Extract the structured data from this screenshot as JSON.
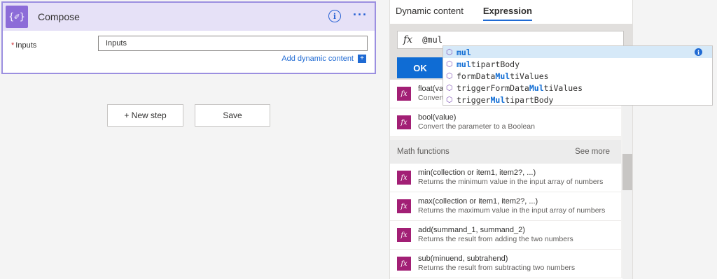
{
  "compose": {
    "title": "Compose",
    "icon": "compose-curly-icon",
    "icon_glyph": "{✐}",
    "info_glyph": "i",
    "more_glyph": "···",
    "required_mark": "*",
    "inputs_label": "Inputs",
    "inputs_value": "Inputs",
    "add_dynamic_label": "Add dynamic content",
    "add_dynamic_glyph": "+"
  },
  "actions": {
    "new_step_label": "+ New step",
    "save_label": "Save"
  },
  "panel": {
    "tabs": [
      "Dynamic content",
      "Expression"
    ],
    "active_tab": "Expression",
    "fx_glyph": "fx",
    "expression_value": "@mul",
    "ok_label": "OK",
    "functions_top": [
      {
        "name": "float(va",
        "desc": "Convert"
      },
      {
        "name": "bool(value)",
        "desc": "Convert the parameter to a Boolean"
      }
    ],
    "math_section": {
      "title": "Math functions",
      "see_more": "See more"
    },
    "math_functions": [
      {
        "name": "min(collection or item1, item2?, ...)",
        "desc": "Returns the minimum value in the input array of numbers"
      },
      {
        "name": "max(collection or item1, item2?, ...)",
        "desc": "Returns the maximum value in the input array of numbers"
      },
      {
        "name": "add(summand_1, summand_2)",
        "desc": "Returns the result from adding the two numbers"
      },
      {
        "name": "sub(minuend, subtrahend)",
        "desc": "Returns the result from subtracting two numbers"
      }
    ]
  },
  "autocomplete": {
    "items": [
      {
        "pre": "",
        "match": "mul",
        "post": "",
        "selected": true
      },
      {
        "pre": "",
        "match": "mul",
        "post": "tipartBody",
        "selected": false
      },
      {
        "pre": "formData",
        "match": "Mul",
        "post": "tiValues",
        "selected": false
      },
      {
        "pre": "triggerFormData",
        "match": "Mul",
        "post": "tiValues",
        "selected": false
      },
      {
        "pre": "trigger",
        "match": "Mul",
        "post": "tipartBody",
        "selected": false
      }
    ],
    "item_icon": "cube-icon"
  },
  "colors": {
    "accent": "#0f6cd4",
    "compose_purple": "#8c6cd8",
    "function_icon": "#a21f75"
  }
}
